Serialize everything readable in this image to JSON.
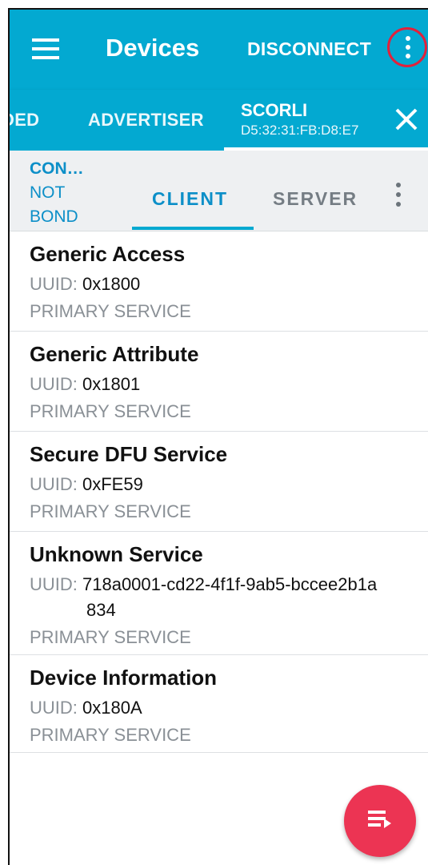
{
  "appbar": {
    "title": "Devices",
    "disconnect_label": "DISCONNECT",
    "menu_icon": "hamburger-menu-icon",
    "overflow_icon": "more-vert-icon"
  },
  "device_tabs": {
    "prev_partial_label": "DED",
    "advertiser_label": "ADVERTISER",
    "active": {
      "name": "SCORLI",
      "address": "D5:32:31:FB:D8:E7"
    },
    "close_icon": "close-icon"
  },
  "connection": {
    "state_line1": "CON…",
    "state_line2": "NOT",
    "state_line3": "BOND"
  },
  "subtabs": {
    "client_label": "CLIENT",
    "server_label": "SERVER"
  },
  "services": [
    {
      "name": "Generic Access",
      "uuid_label": "UUID: ",
      "uuid": "0x1800",
      "type": "PRIMARY SERVICE"
    },
    {
      "name": "Generic Attribute",
      "uuid_label": "UUID: ",
      "uuid": "0x1801",
      "type": "PRIMARY SERVICE"
    },
    {
      "name": "Secure DFU Service",
      "uuid_label": "UUID: ",
      "uuid": "0xFE59",
      "type": "PRIMARY SERVICE"
    },
    {
      "name": "Unknown Service",
      "uuid_label": "UUID: ",
      "uuid": "718a0001-cd22-4f1f-9ab5-bccee2b1a",
      "uuid_cont": "834",
      "type": "PRIMARY SERVICE"
    },
    {
      "name": "Device Information",
      "uuid_label": "UUID: ",
      "uuid": "0x180A",
      "type": "PRIMARY SERVICE"
    }
  ],
  "fab": {
    "icon": "playlist-play-icon"
  },
  "colors": {
    "primary": "#03a9d1",
    "accent": "#0c8fc8",
    "fab": "#ec3453",
    "highlight_circle": "#e2213b"
  }
}
